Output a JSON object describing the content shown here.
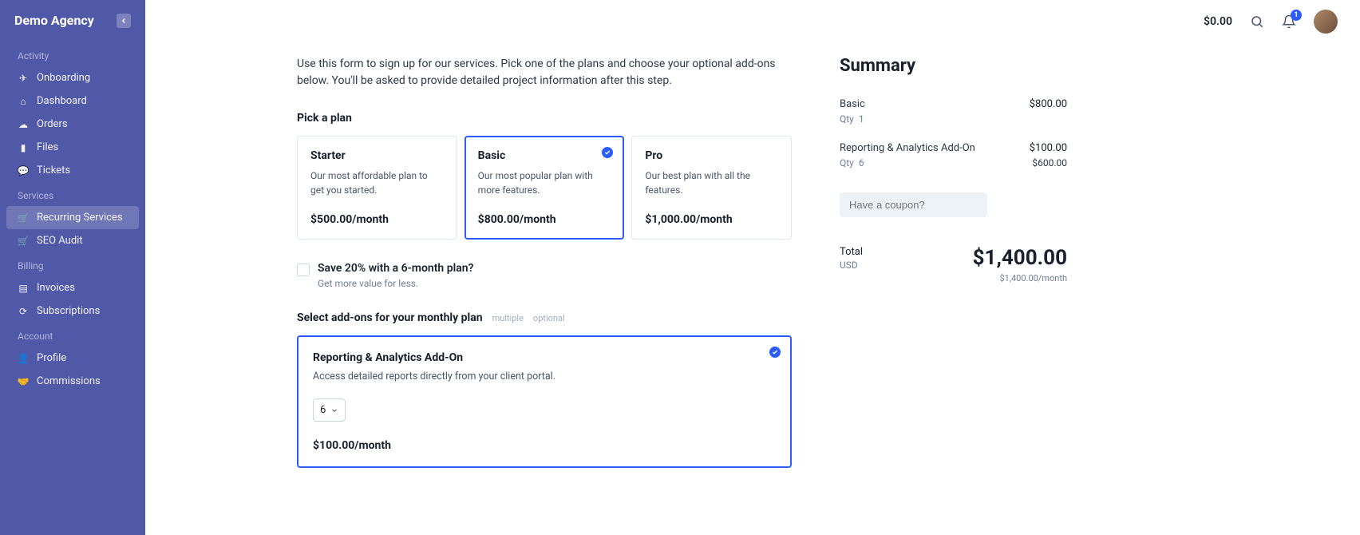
{
  "brand": "Demo Agency",
  "sidebar": {
    "sections": [
      {
        "label": "Activity",
        "items": [
          {
            "icon": "onboarding",
            "label": "Onboarding"
          },
          {
            "icon": "dashboard",
            "label": "Dashboard"
          },
          {
            "icon": "orders",
            "label": "Orders"
          },
          {
            "icon": "files",
            "label": "Files"
          },
          {
            "icon": "tickets",
            "label": "Tickets"
          }
        ]
      },
      {
        "label": "Services",
        "items": [
          {
            "icon": "cart",
            "label": "Recurring Services",
            "active": true
          },
          {
            "icon": "cart",
            "label": "SEO Audit"
          }
        ]
      },
      {
        "label": "Billing",
        "items": [
          {
            "icon": "invoices",
            "label": "Invoices"
          },
          {
            "icon": "subscriptions",
            "label": "Subscriptions"
          }
        ]
      },
      {
        "label": "Account",
        "items": [
          {
            "icon": "profile",
            "label": "Profile"
          },
          {
            "icon": "commissions",
            "label": "Commissions"
          }
        ]
      }
    ]
  },
  "header": {
    "balance": "$0.00",
    "notifications_count": "1"
  },
  "intro": "Use this form to sign up for our services. Pick one of the plans and choose your optional add-ons below. You'll be asked to provide detailed project information after this step.",
  "pick_plan_title": "Pick a plan",
  "plans": [
    {
      "name": "Starter",
      "desc": "Our most affordable plan to get you started.",
      "price": "$500.00/month",
      "selected": false
    },
    {
      "name": "Basic",
      "desc": "Our most popular plan with more features.",
      "price": "$800.00/month",
      "selected": true
    },
    {
      "name": "Pro",
      "desc": "Our best plan with all the features.",
      "price": "$1,000.00/month",
      "selected": false
    }
  ],
  "checkbox": {
    "label": "Save 20% with a 6-month plan?",
    "sub": "Get more value for less."
  },
  "addons_title": "Select add-ons for your monthly plan",
  "tags": {
    "multiple": "multiple",
    "optional": "optional"
  },
  "addon": {
    "name": "Reporting & Analytics Add-On",
    "desc": "Access detailed reports directly from your client portal.",
    "qty": "6",
    "price": "$100.00/month"
  },
  "summary": {
    "title": "Summary",
    "items": [
      {
        "name": "Basic",
        "qty_label": "Qty",
        "qty": "1",
        "price": "$800.00",
        "sub": ""
      },
      {
        "name": "Reporting & Analytics Add-On",
        "qty_label": "Qty",
        "qty": "6",
        "price": "$100.00",
        "sub": "$600.00"
      }
    ],
    "coupon_placeholder": "Have a coupon?",
    "total_label": "Total",
    "currency": "USD",
    "total_amount": "$1,400.00",
    "total_sub": "$1,400.00/month"
  }
}
